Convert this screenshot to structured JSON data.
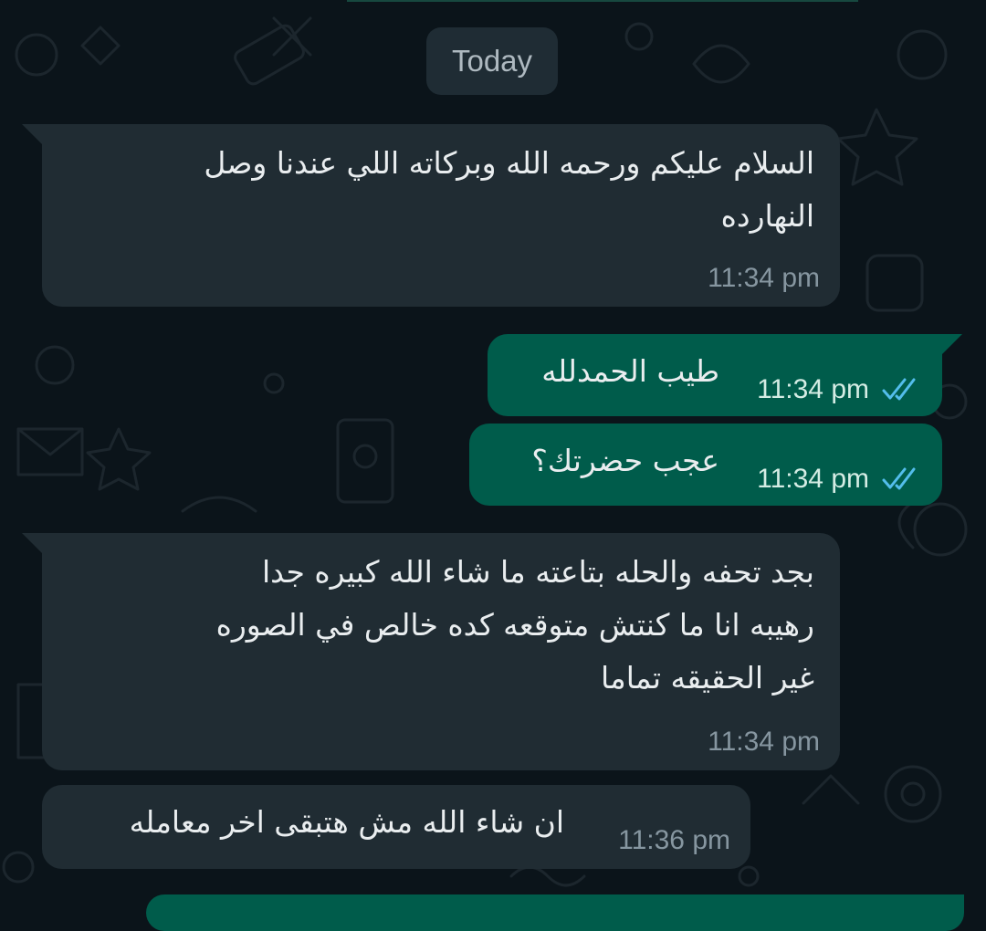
{
  "chat": {
    "date_separator": "Today",
    "messages": [
      {
        "direction": "incoming",
        "lines": [
          "السلام عليكم ورحمه الله وبركاته اللي عندنا وصل",
          "النهارده"
        ],
        "time": "11:34 pm"
      },
      {
        "direction": "outgoing",
        "lines": [
          "طيب الحمدلله"
        ],
        "time": "11:34 pm",
        "status": "read-double-check-icon"
      },
      {
        "direction": "outgoing",
        "lines": [
          "عجب حضرتك؟"
        ],
        "time": "11:34 pm",
        "status": "read-double-check-icon"
      },
      {
        "direction": "incoming",
        "lines": [
          "بجد تحفه والحله بتاعته ما شاء الله كبيره جدا",
          "رهيبه انا ما كنتش متوقعه كده خالص في الصوره",
          "غير الحقيقه تماما"
        ],
        "time": "11:34 pm"
      },
      {
        "direction": "incoming",
        "lines": [
          "ان شاء الله مش هتبقى اخر معامله"
        ],
        "time": "11:36 pm"
      }
    ]
  },
  "colors": {
    "background": "#0b141a",
    "incoming_bubble": "#202c33",
    "outgoing_bubble": "#005c4b",
    "read_ticks": "#53bdeb",
    "text": "#e9edef",
    "timestamp": "#8696a0"
  }
}
